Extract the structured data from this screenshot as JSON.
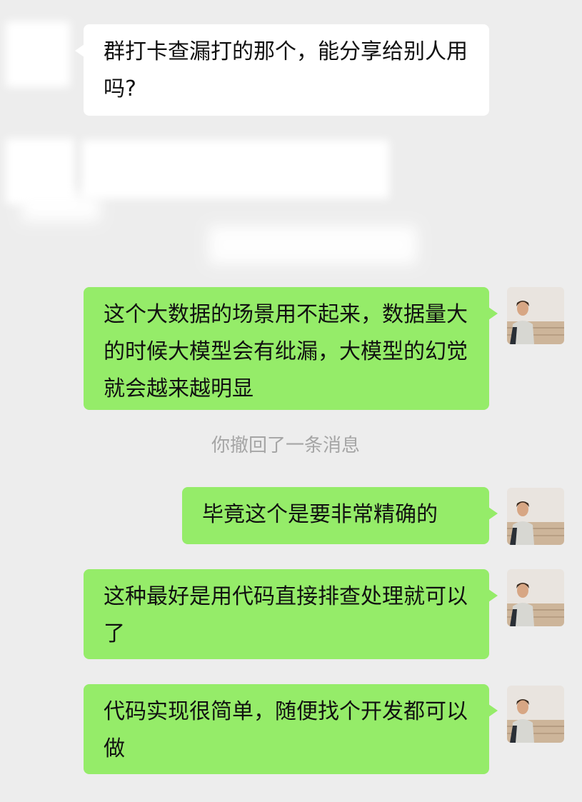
{
  "conversation": {
    "messages": [
      {
        "sender": "other",
        "text": "群打卡查漏打的那个，能分享给别人用吗?"
      },
      {
        "sender": "other",
        "text": ""
      },
      {
        "sender": "self",
        "text": "这个大数据的场景用不起来，数据量大的时候大模型会有纰漏，大模型的幻觉就会越来越明显"
      },
      {
        "sender": "system",
        "text": "你撤回了一条消息"
      },
      {
        "sender": "self",
        "text": "毕竟这个是要非常精确的"
      },
      {
        "sender": "self",
        "text": "这种最好是用代码直接排查处理就可以了"
      },
      {
        "sender": "self",
        "text": "代码实现很简单，随便找个开发都可以做"
      }
    ]
  },
  "colors": {
    "background": "#ededed",
    "incoming_bubble": "#ffffff",
    "outgoing_bubble": "#95ec69",
    "system_text": "#a5a5a5"
  },
  "icons": {
    "self_avatar": "user-avatar-icon",
    "other_avatar": "redacted-avatar"
  }
}
